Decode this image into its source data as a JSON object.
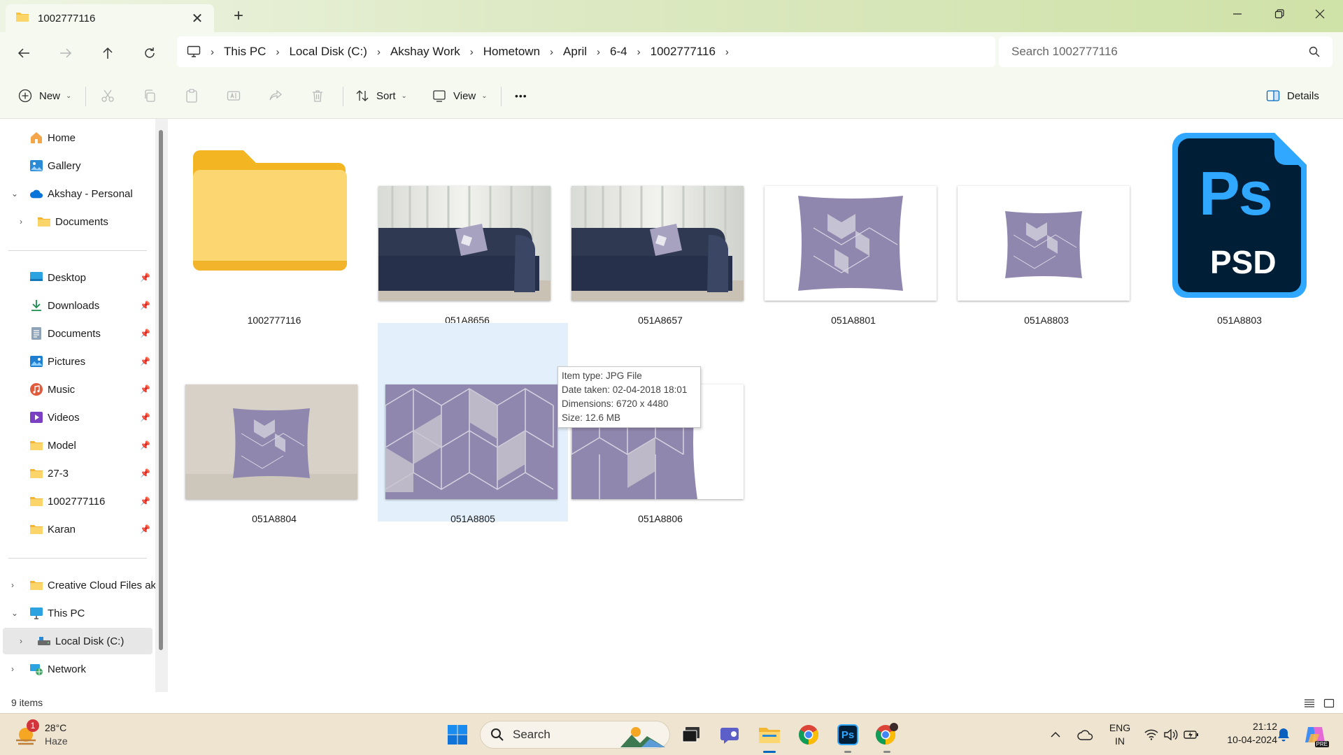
{
  "window": {
    "tab_title": "1002777116",
    "new_tab": "+",
    "close_tab": "✕"
  },
  "address": {
    "crumbs": [
      "This PC",
      "Local Disk (C:)",
      "Akshay Work",
      "Hometown",
      "April",
      "6-4",
      "1002777116"
    ],
    "search_placeholder": "Search 1002777116"
  },
  "toolbar": {
    "new_label": "New",
    "sort_label": "Sort",
    "view_label": "View",
    "more_label": "•••",
    "details_label": "Details"
  },
  "sidebar": {
    "top": [
      {
        "label": "Home"
      },
      {
        "label": "Gallery"
      },
      {
        "label": "Akshay - Personal"
      },
      {
        "label": "Documents"
      }
    ],
    "quick": [
      {
        "label": "Desktop"
      },
      {
        "label": "Downloads"
      },
      {
        "label": "Documents"
      },
      {
        "label": "Pictures"
      },
      {
        "label": "Music"
      },
      {
        "label": "Videos"
      },
      {
        "label": "Model"
      },
      {
        "label": "27-3"
      },
      {
        "label": "1002777116"
      },
      {
        "label": "Karan"
      }
    ],
    "bottom": [
      {
        "label": "Creative Cloud Files  ak"
      },
      {
        "label": "This PC"
      },
      {
        "label": "Local Disk (C:)"
      },
      {
        "label": "Network"
      }
    ]
  },
  "files": [
    {
      "name": "1002777116",
      "kind": "folder"
    },
    {
      "name": "051A8656",
      "kind": "photo-sofa"
    },
    {
      "name": "051A8657",
      "kind": "photo-sofa"
    },
    {
      "name": "051A8801",
      "kind": "photo-pillow"
    },
    {
      "name": "051A8803",
      "kind": "photo-pillow-small"
    },
    {
      "name": "051A8803",
      "kind": "psd"
    },
    {
      "name": "051A8804",
      "kind": "photo-pillow-wall"
    },
    {
      "name": "051A8805",
      "kind": "photo-closeup"
    },
    {
      "name": "051A8806",
      "kind": "photo-closeup-edge"
    }
  ],
  "psd_icon": {
    "top_text": "Ps",
    "bottom_text": "PSD"
  },
  "tooltip": {
    "type": "Item type: JPG File",
    "date": "Date taken: 02-04-2018 18:01",
    "dimensions": "Dimensions: 6720 x 4480",
    "size": "Size: 12.6 MB"
  },
  "status": {
    "item_count": "9 items"
  },
  "taskbar": {
    "weather_temp": "28°C",
    "weather_desc": "Haze",
    "weather_badge": "1",
    "search_label": "Search",
    "ps_label": "Ps",
    "lang_top": "ENG",
    "lang_bottom": "IN",
    "time": "21:12",
    "date": "10-04-2024",
    "pre_badge": "PRE"
  },
  "colors": {
    "accent": "#0067c0",
    "folder": "#f8c43c",
    "ps_dark": "#001e36",
    "ps_blue": "#31a8ff",
    "pillow": "#8f87ad"
  }
}
